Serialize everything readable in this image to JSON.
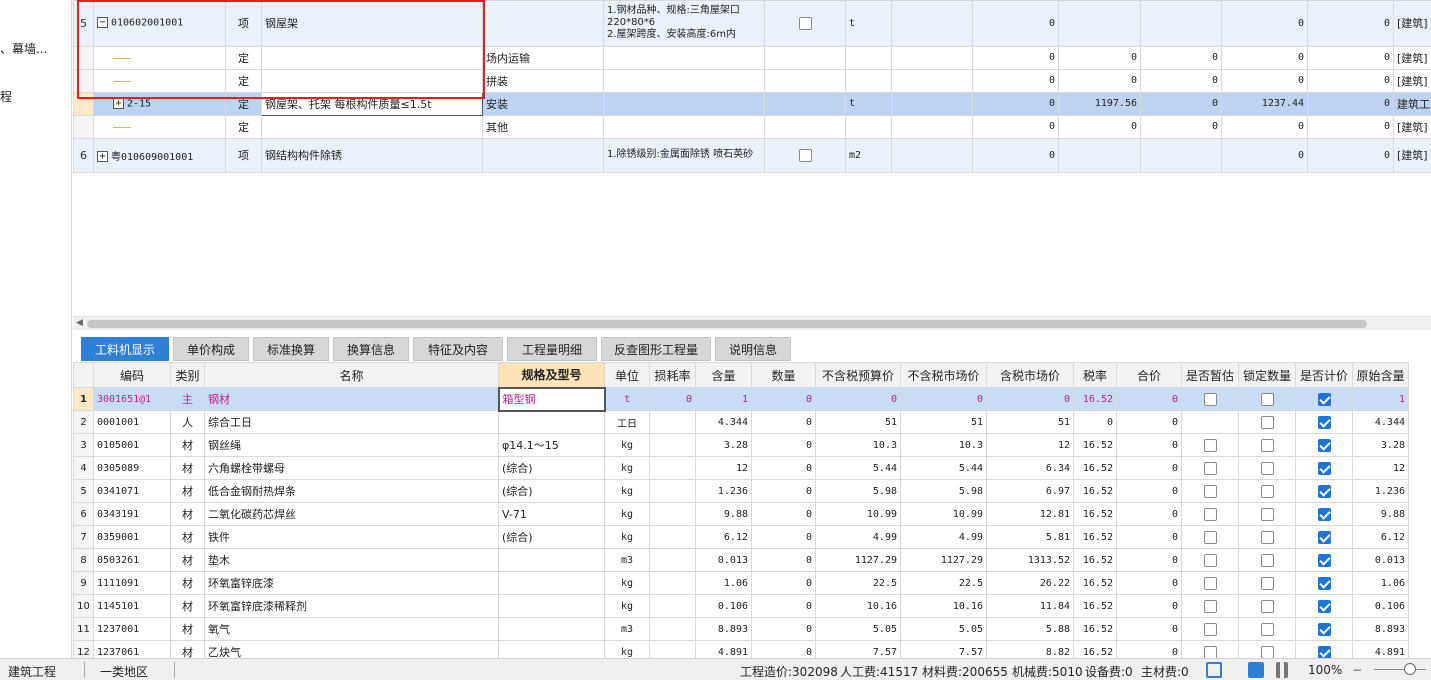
{
  "left_panel": {
    "items": [
      "、幕墙...",
      "程"
    ]
  },
  "upper_grid": {
    "rows": [
      {
        "index": "5",
        "code": "010602001001",
        "type": "项",
        "name": "钢屋架",
        "work": "",
        "features": "1.钢材品种、规格:三角屋架口220*80*6\n2.屋架跨度、安装高度:6m内",
        "unit": "t",
        "v1": "0",
        "v2": "",
        "v3": "",
        "v4": "0",
        "v5": "0",
        "prof": "[建筑]"
      },
      {
        "index": "",
        "code": "",
        "type": "定",
        "name": "",
        "work": "场内运输",
        "features": "",
        "unit": "",
        "v1": "0",
        "v2": "0",
        "v3": "0",
        "v4": "0",
        "v5": "0",
        "prof": "[建筑]"
      },
      {
        "index": "",
        "code": "",
        "type": "定",
        "name": "",
        "work": "拼装",
        "features": "",
        "unit": "",
        "v1": "0",
        "v2": "0",
        "v3": "0",
        "v4": "0",
        "v5": "0",
        "prof": "[建筑]"
      },
      {
        "index": "",
        "code": "2-15",
        "type": "定",
        "name": "钢屋架、托架 每根构件质量≤1.5t",
        "work": "安装",
        "features": "",
        "unit": "t",
        "v1": "0",
        "v2": "1197.56",
        "v3": "0",
        "v4": "1237.44",
        "v5": "0",
        "prof": "建筑工"
      },
      {
        "index": "",
        "code": "",
        "type": "定",
        "name": "",
        "work": "其他",
        "features": "",
        "unit": "",
        "v1": "0",
        "v2": "0",
        "v3": "0",
        "v4": "0",
        "v5": "0",
        "prof": "[建筑]"
      },
      {
        "index": "6",
        "code": "粤010609001001",
        "type": "项",
        "name": "钢结构构件除锈",
        "work": "",
        "features": "1.除锈级别:金属面除锈 喷石英砂",
        "unit": "m2",
        "v1": "0",
        "v2": "",
        "v3": "",
        "v4": "0",
        "v5": "0",
        "prof": "[建筑]"
      }
    ]
  },
  "tabs": [
    "工料机显示",
    "单价构成",
    "标准换算",
    "换算信息",
    "特征及内容",
    "工程量明细",
    "反查图形工程量",
    "说明信息"
  ],
  "lower_grid": {
    "headers": [
      "编码",
      "类别",
      "名称",
      "规格及型号",
      "单位",
      "损耗率",
      "含量",
      "数量",
      "不含税预算价",
      "不含税市场价",
      "含税市场价",
      "税率",
      "合价",
      "是否暂估",
      "锁定数量",
      "是否计价",
      "原始含量"
    ],
    "rows": [
      {
        "n": "1",
        "code": "3001651@1",
        "cat": "主",
        "name": "钢材",
        "spec": "箱型钢",
        "unit": "t",
        "loss": "0",
        "qty": "1",
        "amt": "0",
        "p1": "0",
        "p2": "0",
        "p3": "0",
        "tax": "16.52",
        "total": "0",
        "orig": "1"
      },
      {
        "n": "2",
        "code": "0001001",
        "cat": "人",
        "name": "综合工日",
        "spec": "",
        "unit": "工日",
        "loss": "",
        "qty": "4.344",
        "amt": "0",
        "p1": "51",
        "p2": "51",
        "p3": "51",
        "tax": "0",
        "total": "0",
        "orig": "4.344"
      },
      {
        "n": "3",
        "code": "0105001",
        "cat": "材",
        "name": "钢丝绳",
        "spec": "φ14.1～15",
        "unit": "kg",
        "loss": "",
        "qty": "3.28",
        "amt": "0",
        "p1": "10.3",
        "p2": "10.3",
        "p3": "12",
        "tax": "16.52",
        "total": "0",
        "orig": "3.28"
      },
      {
        "n": "4",
        "code": "0305089",
        "cat": "材",
        "name": "六角螺栓带螺母",
        "spec": "(综合)",
        "unit": "kg",
        "loss": "",
        "qty": "12",
        "amt": "0",
        "p1": "5.44",
        "p2": "5.44",
        "p3": "6.34",
        "tax": "16.52",
        "total": "0",
        "orig": "12"
      },
      {
        "n": "5",
        "code": "0341071",
        "cat": "材",
        "name": "低合金钢耐热焊条",
        "spec": "(综合)",
        "unit": "kg",
        "loss": "",
        "qty": "1.236",
        "amt": "0",
        "p1": "5.98",
        "p2": "5.98",
        "p3": "6.97",
        "tax": "16.52",
        "total": "0",
        "orig": "1.236"
      },
      {
        "n": "6",
        "code": "0343191",
        "cat": "材",
        "name": "二氧化碳药芯焊丝",
        "spec": "V-71",
        "unit": "kg",
        "loss": "",
        "qty": "9.88",
        "amt": "0",
        "p1": "10.99",
        "p2": "10.99",
        "p3": "12.81",
        "tax": "16.52",
        "total": "0",
        "orig": "9.88"
      },
      {
        "n": "7",
        "code": "0359001",
        "cat": "材",
        "name": "铁件",
        "spec": "(综合)",
        "unit": "kg",
        "loss": "",
        "qty": "6.12",
        "amt": "0",
        "p1": "4.99",
        "p2": "4.99",
        "p3": "5.81",
        "tax": "16.52",
        "total": "0",
        "orig": "6.12"
      },
      {
        "n": "8",
        "code": "0503261",
        "cat": "材",
        "name": "垫木",
        "spec": "",
        "unit": "m3",
        "loss": "",
        "qty": "0.013",
        "amt": "0",
        "p1": "1127.29",
        "p2": "1127.29",
        "p3": "1313.52",
        "tax": "16.52",
        "total": "0",
        "orig": "0.013"
      },
      {
        "n": "9",
        "code": "1111091",
        "cat": "材",
        "name": "环氧富锌底漆",
        "spec": "",
        "unit": "kg",
        "loss": "",
        "qty": "1.06",
        "amt": "0",
        "p1": "22.5",
        "p2": "22.5",
        "p3": "26.22",
        "tax": "16.52",
        "total": "0",
        "orig": "1.06"
      },
      {
        "n": "10",
        "code": "1145101",
        "cat": "材",
        "name": "环氧富锌底漆稀释剂",
        "spec": "",
        "unit": "kg",
        "loss": "",
        "qty": "0.106",
        "amt": "0",
        "p1": "10.16",
        "p2": "10.16",
        "p3": "11.84",
        "tax": "16.52",
        "total": "0",
        "orig": "0.106"
      },
      {
        "n": "11",
        "code": "1237001",
        "cat": "材",
        "name": "氧气",
        "spec": "",
        "unit": "m3",
        "loss": "",
        "qty": "8.893",
        "amt": "0",
        "p1": "5.05",
        "p2": "5.05",
        "p3": "5.88",
        "tax": "16.52",
        "total": "0",
        "orig": "8.893"
      },
      {
        "n": "12",
        "code": "1237061",
        "cat": "材",
        "name": "乙炔气",
        "spec": "",
        "unit": "kg",
        "loss": "",
        "qty": "4.891",
        "amt": "0",
        "p1": "7.57",
        "p2": "7.57",
        "p3": "8.82",
        "tax": "16.52",
        "total": "0",
        "orig": "4.891"
      }
    ]
  },
  "status": {
    "profession": "建筑工程",
    "region": "一类地区",
    "cost": "工程造价:302098",
    "labor": "人工费:41517",
    "material": "材料费:200655",
    "machine": "机械费:5010",
    "equipment": "设备费:0",
    "main_material": "主材费:0",
    "zoom": "100%"
  },
  "colors": {
    "accent": "#2f7fd6",
    "highlight_red": "#e02020",
    "main_material_text": "#b8238e"
  }
}
